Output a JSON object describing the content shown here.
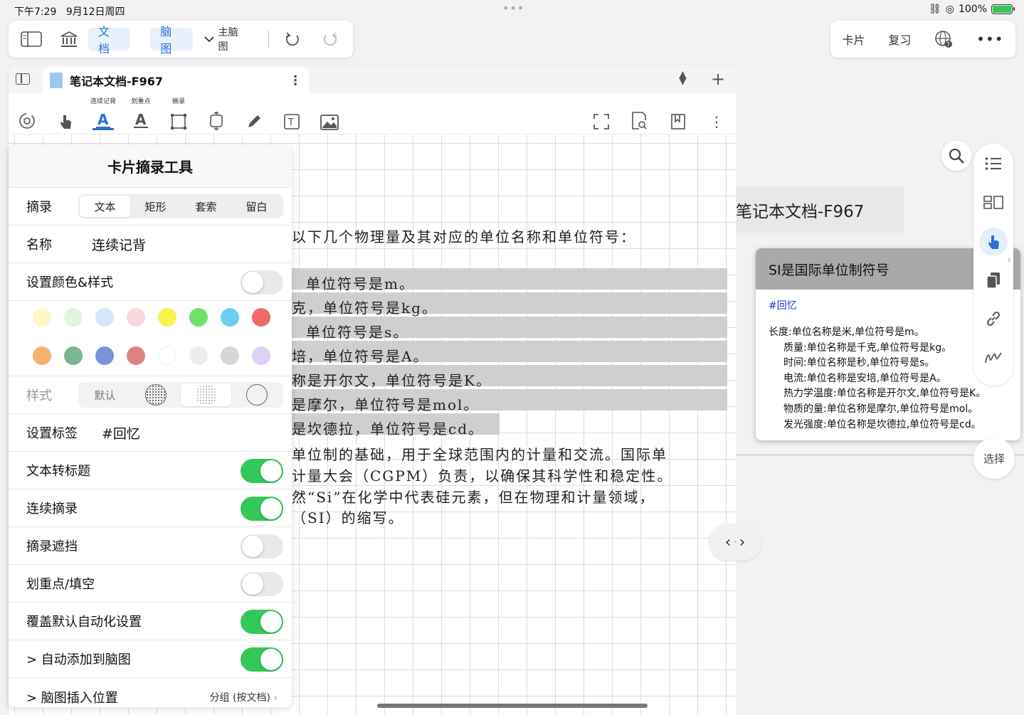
{
  "status": {
    "time": "下午7:29",
    "date": "9月12日周四",
    "battery": "100%",
    "battery_level": 1.0
  },
  "toolbar": {
    "doc_tab": "文档",
    "mindmap_tab": "脑图",
    "mindmap_select": "主脑图"
  },
  "top_right": {
    "cards": "卡片",
    "review": "复习"
  },
  "document": {
    "tab_title": "笔记本文档-F967",
    "tool_labels": {
      "continuous": "连续记背",
      "highlight": "划重点",
      "excerpt": "摘录"
    },
    "lines": [
      "以下几个物理量及其对应的单位名称和单位符号：",
      "单位符号是m。",
      "克，单位符号是kg。",
      "单位符号是s。",
      "培，单位符号是A。",
      "称是开尔文，单位符号是K。",
      "是摩尔，单位符号是mol。",
      "是坎德拉，单位符号是cd。",
      "单位制的基础，用于全球范围内的计量和交流。国际单",
      "计量大会（CGPM）负责，以确保其科学性和稳定性。",
      "然“Si”在化学中代表硅元素，但在物理和计量领域，",
      "（SI）的缩写。"
    ]
  },
  "card_panel": {
    "title": "卡片摘录工具",
    "excerpt_label": "摘录",
    "excerpt_modes": [
      "文本",
      "矩形",
      "套索",
      "留白"
    ],
    "excerpt_selected": 0,
    "name_label": "名称",
    "name_value": "连续记背",
    "color_style_label": "设置颜色&样式",
    "color_style_on": false,
    "colors": [
      "#fdf8c4",
      "#dff5dc",
      "#d6e6fa",
      "#fad7df",
      "#f7f24d",
      "#6fe06b",
      "#6bcdf2",
      "#f06a6a",
      "#f9b06b",
      "#7cb58f",
      "#7a93d9",
      "#df8181",
      "#ffffff",
      "#ececec",
      "#d6d6d6",
      "#e0d0f3"
    ],
    "style_label": "样式",
    "style_default": "默认",
    "tag_label": "设置标签",
    "tag_value": "#回忆",
    "settings": [
      {
        "label": "文本转标题",
        "on": true
      },
      {
        "label": "连续摘录",
        "on": true
      },
      {
        "label": "摘录遮挡",
        "on": false
      },
      {
        "label": "划重点/填空",
        "on": false
      },
      {
        "label": "覆盖默认自动化设置",
        "on": true
      },
      {
        "label": "> 自动添加到脑图",
        "on": true
      }
    ],
    "insert_pos_label": "> 脑图插入位置",
    "insert_pos_value": "分组 (按文档)"
  },
  "mindmap": {
    "title": "笔记本文档-F967",
    "card_title": "SI是国际单位制符号",
    "card_tag": "#回忆",
    "card_lines": [
      "长度:单位名称是米,单位符号是m。",
      "质量:单位名称是千克,单位符号是kg。",
      "时间:单位名称是秒,单位符号是s。",
      "电流:单位名称是安培,单位符号是A。",
      "热力学温度:单位名称是开尔文,单位符号是K。",
      "物质的量:单位名称是摩尔,单位符号是mol。",
      "发光强度:单位名称是坎德拉,单位符号是cd。"
    ],
    "select_label": "选择"
  }
}
